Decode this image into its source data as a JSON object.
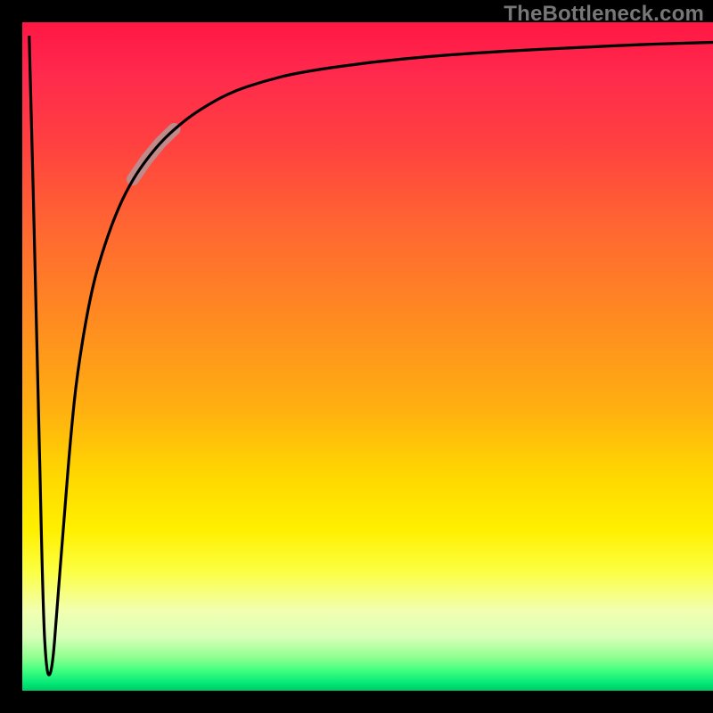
{
  "watermark": "TheBottleneck.com",
  "chart_data": {
    "type": "line",
    "title": "",
    "xlabel": "",
    "ylabel": "",
    "xlim": [
      0,
      100
    ],
    "ylim": [
      0,
      100
    ],
    "grid": false,
    "legend": false,
    "gradient_background": {
      "top_color": "#ff1744",
      "mid_color": "#ffd800",
      "bottom_color": "#00e676",
      "meaning": "red=high bottleneck, green=no bottleneck"
    },
    "highlight_segment": {
      "x_range": [
        15,
        22
      ],
      "style": "thick-muted"
    },
    "series": [
      {
        "name": "bottleneck-curve",
        "x": [
          1.0,
          2.2,
          3.0,
          3.5,
          4.0,
          4.5,
          5.0,
          6.0,
          7.0,
          8.0,
          10.0,
          12.0,
          14.0,
          16.0,
          18.0,
          20.0,
          22.0,
          25.0,
          30.0,
          35.0,
          40.0,
          50.0,
          60.0,
          70.0,
          80.0,
          90.0,
          100.0
        ],
        "values": [
          98.0,
          50.0,
          12.0,
          3.0,
          2.0,
          5.0,
          12.0,
          25.0,
          38.0,
          48.0,
          60.0,
          67.0,
          72.5,
          76.5,
          79.5,
          82.0,
          84.0,
          86.5,
          89.5,
          91.2,
          92.5,
          94.0,
          95.0,
          95.7,
          96.2,
          96.7,
          97.0
        ]
      }
    ]
  }
}
